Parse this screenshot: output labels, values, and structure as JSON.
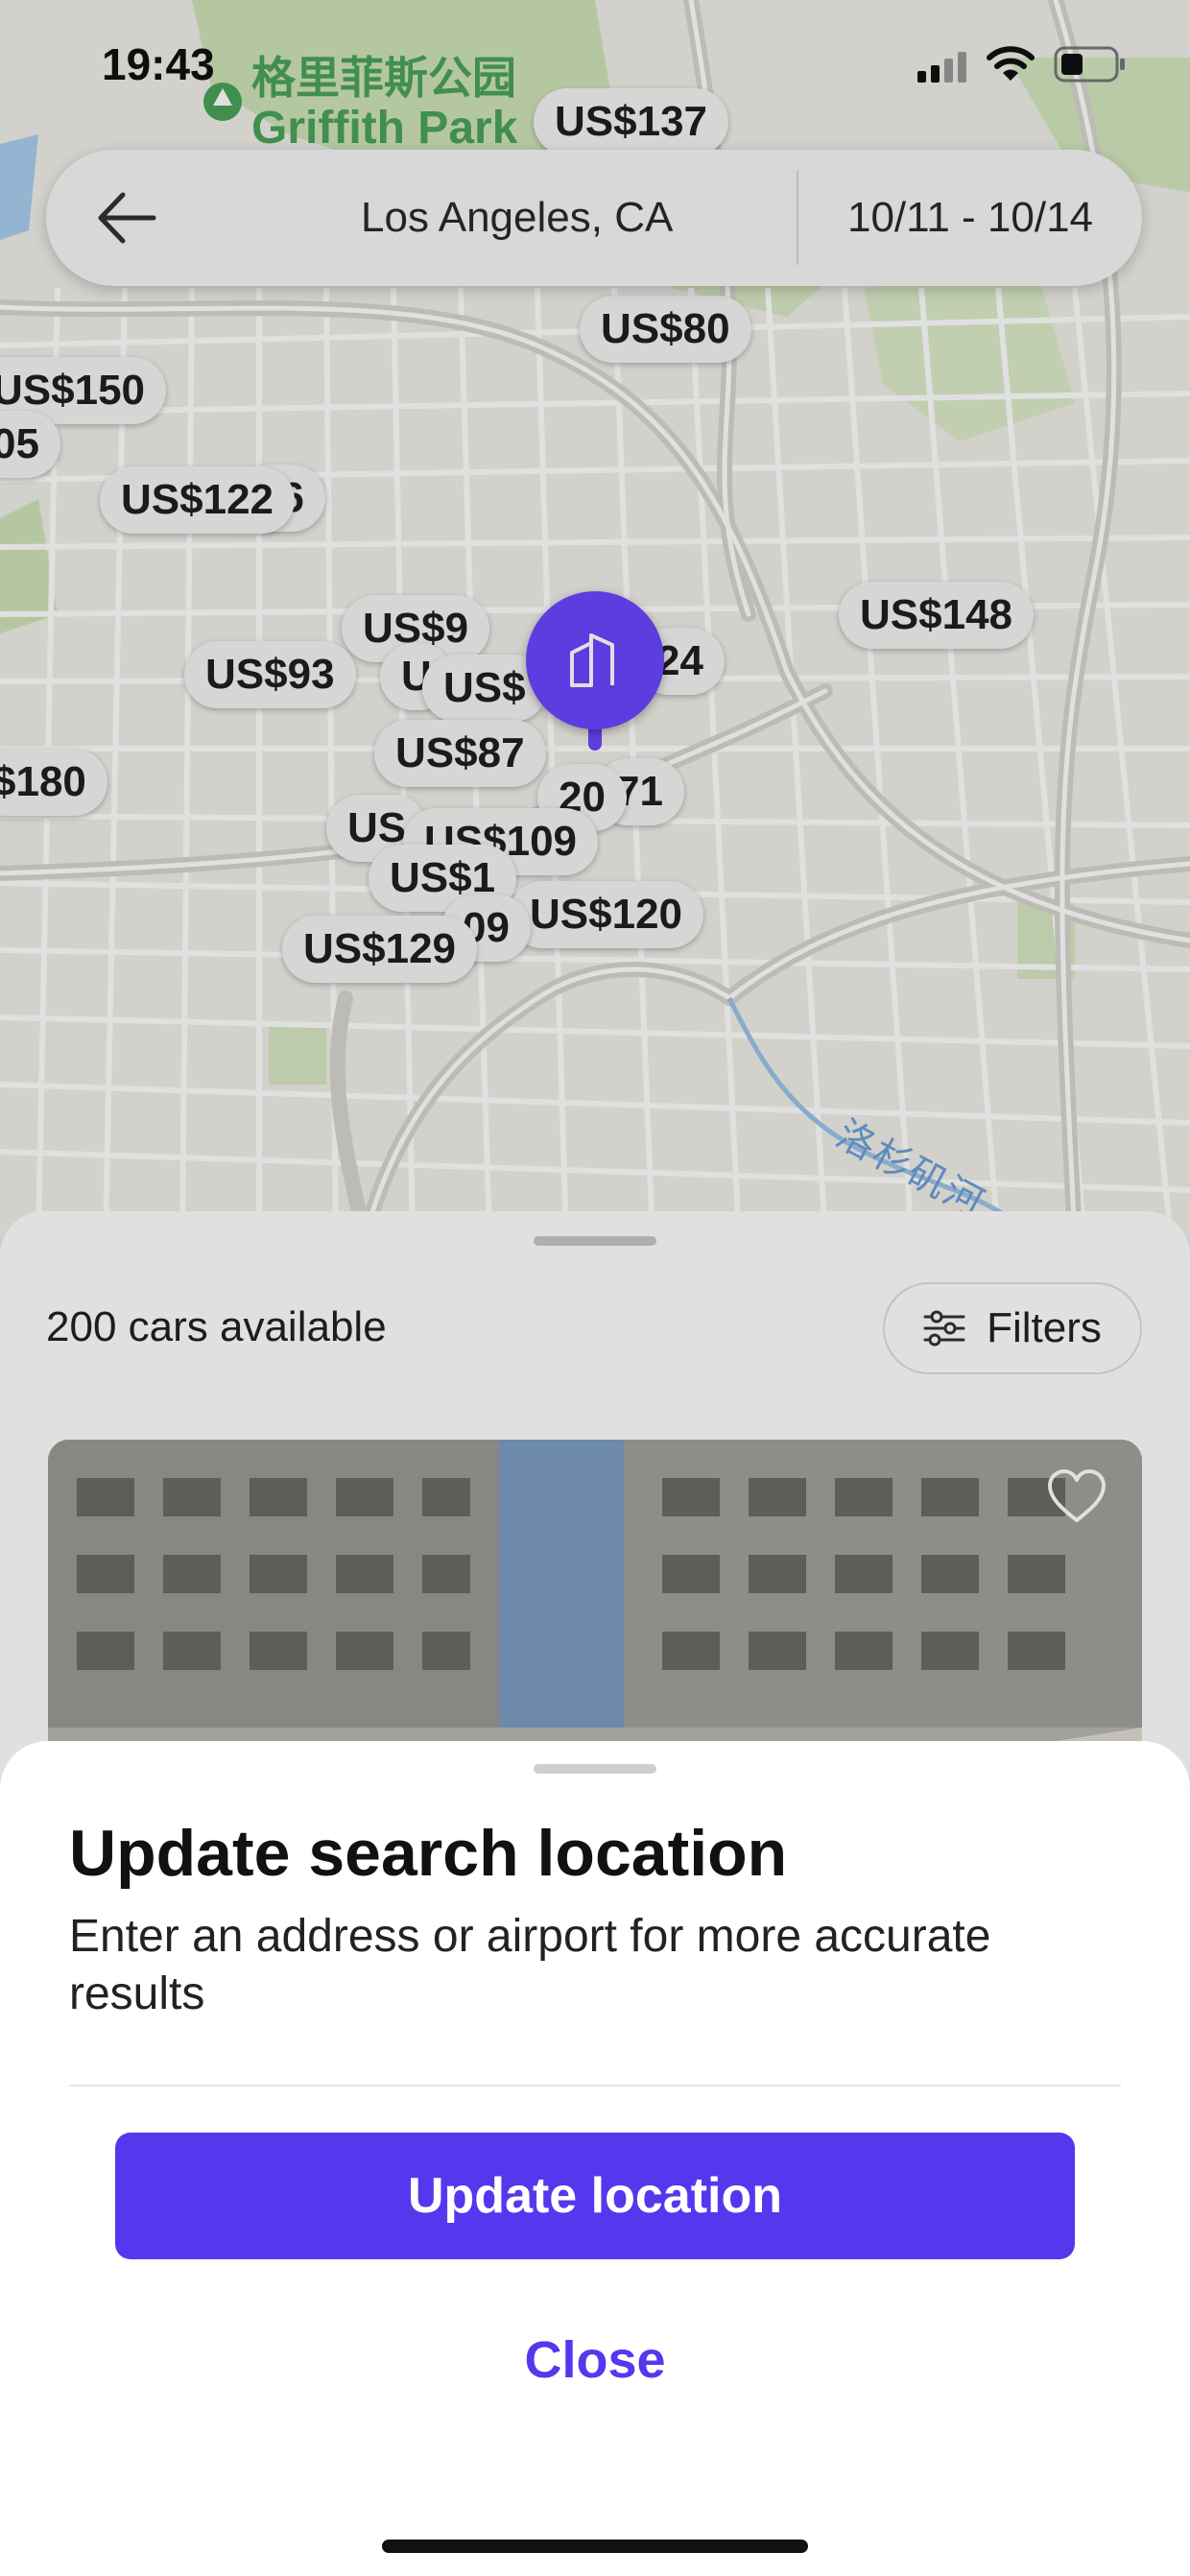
{
  "status_bar": {
    "time": "19:43"
  },
  "map": {
    "park_label_cn": "格里菲斯公园",
    "park_label_en": "Griffith Park",
    "river_label": "洛杉矶河",
    "price_pins": [
      "US$137",
      "US$80",
      "US$150",
      "05",
      "US$122",
      "56",
      "US$148",
      "US$93",
      "US$9",
      "U",
      "US$",
      "24",
      "$180",
      "US$87",
      "20",
      "71",
      "US",
      "US$109",
      "US$1",
      "09",
      "US$120",
      "US$129"
    ],
    "selected_marker_icon": "building-icon"
  },
  "search": {
    "location": "Los Angeles, CA",
    "dates": "10/11 - 10/14"
  },
  "list": {
    "count_label": "200 cars available",
    "filters_label": "Filters"
  },
  "modal": {
    "title": "Update search location",
    "description": "Enter an address or airport for more accurate results",
    "primary_button": "Update location",
    "close_button": "Close"
  },
  "colors": {
    "accent": "#5438ee",
    "map_marker": "#6a46ff",
    "park_green": "#4aa35a"
  }
}
